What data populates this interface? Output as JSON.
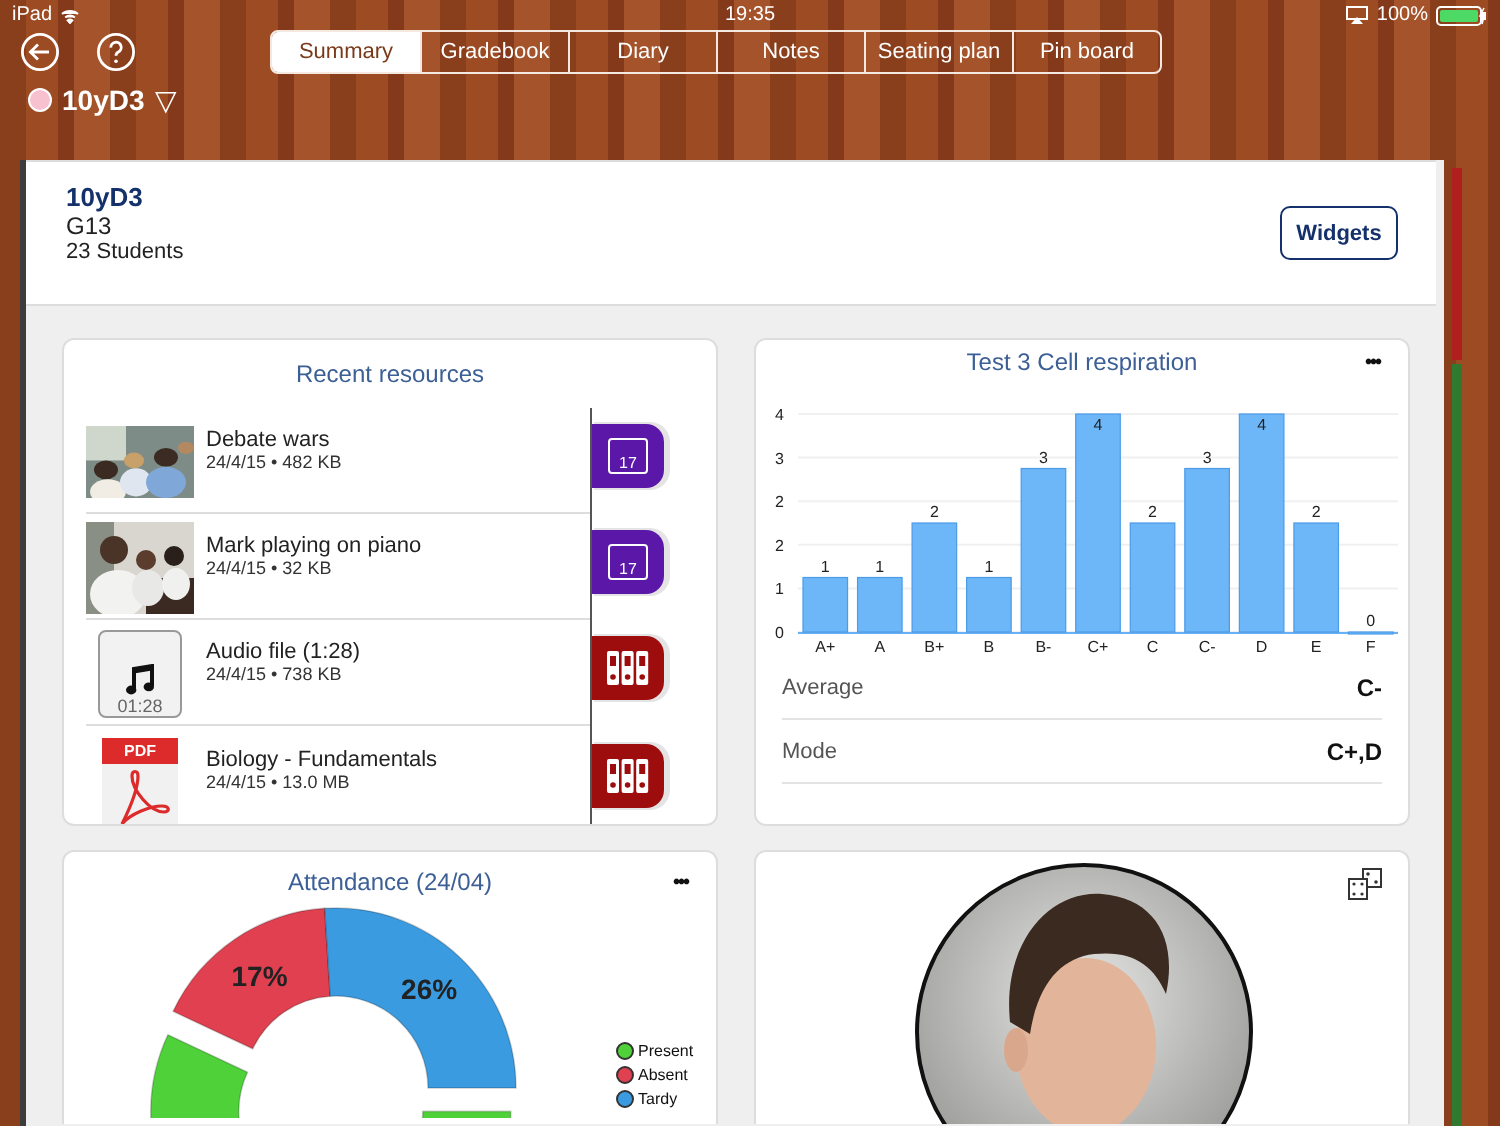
{
  "status_bar": {
    "device": "iPad",
    "time": "19:35",
    "battery": "100%"
  },
  "nav": {
    "tabs": [
      {
        "label": "Summary",
        "selected": true
      },
      {
        "label": "Gradebook",
        "selected": false
      },
      {
        "label": "Diary",
        "selected": false
      },
      {
        "label": "Notes",
        "selected": false
      },
      {
        "label": "Seating plan",
        "selected": false
      },
      {
        "label": "Pin board",
        "selected": false
      }
    ]
  },
  "class_picker": {
    "label": "10yD3",
    "caret": "▽"
  },
  "header": {
    "title": "10yD3",
    "room": "G13",
    "students": "23 Students",
    "button": "Widgets"
  },
  "resources": {
    "title": "Recent resources",
    "items": [
      {
        "name": "Debate wars",
        "meta": "24/4/15 • 482 KB",
        "tag": {
          "kind": "calendar",
          "day": "17"
        }
      },
      {
        "name": "Mark playing on piano",
        "meta": "24/4/15 • 32 KB",
        "tag": {
          "kind": "calendar",
          "day": "17"
        }
      },
      {
        "name": "Audio file (1:28)",
        "meta": "24/4/15 • 738 KB",
        "thumb": {
          "kind": "audio",
          "duration": "01:28"
        },
        "tag": {
          "kind": "binder"
        }
      },
      {
        "name": "Biology - Fundamentals",
        "meta": "24/4/15 • 13.0 MB",
        "thumb": {
          "kind": "pdf",
          "label": "PDF"
        },
        "tag": {
          "kind": "binder"
        }
      }
    ]
  },
  "grades": {
    "more": "•••",
    "chart_data": {
      "type": "bar",
      "title": "Test 3 Cell respiration",
      "categories": [
        "A+",
        "A",
        "B+",
        "B",
        "B-",
        "C+",
        "C",
        "C-",
        "D",
        "E",
        "F"
      ],
      "values": [
        1,
        1,
        2,
        1,
        3,
        4,
        2,
        3,
        4,
        2,
        0
      ],
      "ylim": [
        0,
        4
      ],
      "grid": true,
      "yticks": [
        {
          "value": 0,
          "label": "0"
        },
        {
          "value": 0.8,
          "label": "1"
        },
        {
          "value": 1.6,
          "label": "2"
        },
        {
          "value": 2.4,
          "label": "2"
        },
        {
          "value": 3.2,
          "label": "3"
        },
        {
          "value": 4,
          "label": "4"
        }
      ],
      "data_labels": true
    },
    "stats": [
      {
        "label": "Average",
        "value": "C-"
      },
      {
        "label": "Mode",
        "value": "C+,D"
      }
    ]
  },
  "attendance": {
    "more": "•••",
    "chart_data": {
      "type": "donut",
      "title": "Attendance (24/04)",
      "categories": [
        "Present",
        "Absent",
        "Tardy"
      ],
      "values": [
        57,
        17,
        26
      ],
      "value_labels": [
        null,
        "17%",
        "26%"
      ]
    },
    "legend": [
      {
        "color": "#4fd13a"
      },
      {
        "color": "#e0404f"
      },
      {
        "color": "#3a9be0"
      }
    ]
  }
}
